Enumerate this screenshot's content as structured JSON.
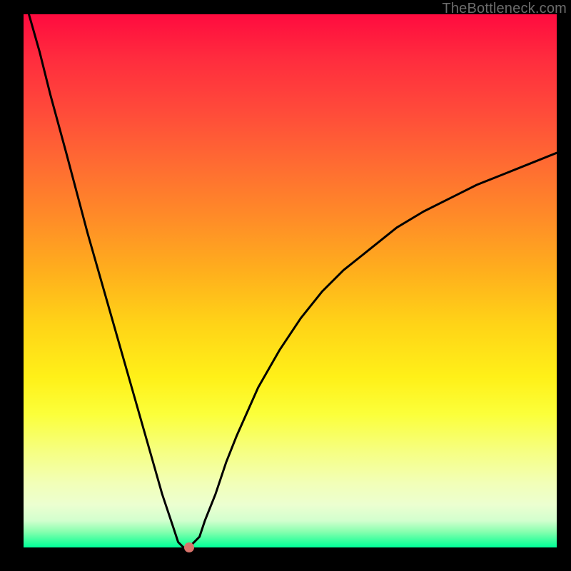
{
  "watermark": "TheBottleneck.com",
  "chart_data": {
    "type": "line",
    "title": "",
    "xlabel": "",
    "ylabel": "",
    "xlim": [
      0,
      100
    ],
    "ylim": [
      0,
      100
    ],
    "grid": false,
    "series": [
      {
        "name": "curve",
        "x": [
          1,
          3,
          5,
          8,
          12,
          16,
          20,
          24,
          26,
          28,
          29,
          30,
          31,
          33,
          34,
          36,
          38,
          40,
          44,
          48,
          52,
          56,
          60,
          65,
          70,
          75,
          80,
          85,
          90,
          95,
          100
        ],
        "values": [
          100,
          93,
          85,
          74,
          59,
          45,
          31,
          17,
          10,
          4,
          1,
          0,
          0,
          2,
          5,
          10,
          16,
          21,
          30,
          37,
          43,
          48,
          52,
          56,
          60,
          63,
          65.5,
          68,
          70,
          72,
          74
        ]
      }
    ],
    "marker": {
      "x": 31,
      "y": 0,
      "color": "#d9736b"
    },
    "background_gradient": {
      "top": "#ff0b3f",
      "bottom": "#00ff99"
    }
  }
}
